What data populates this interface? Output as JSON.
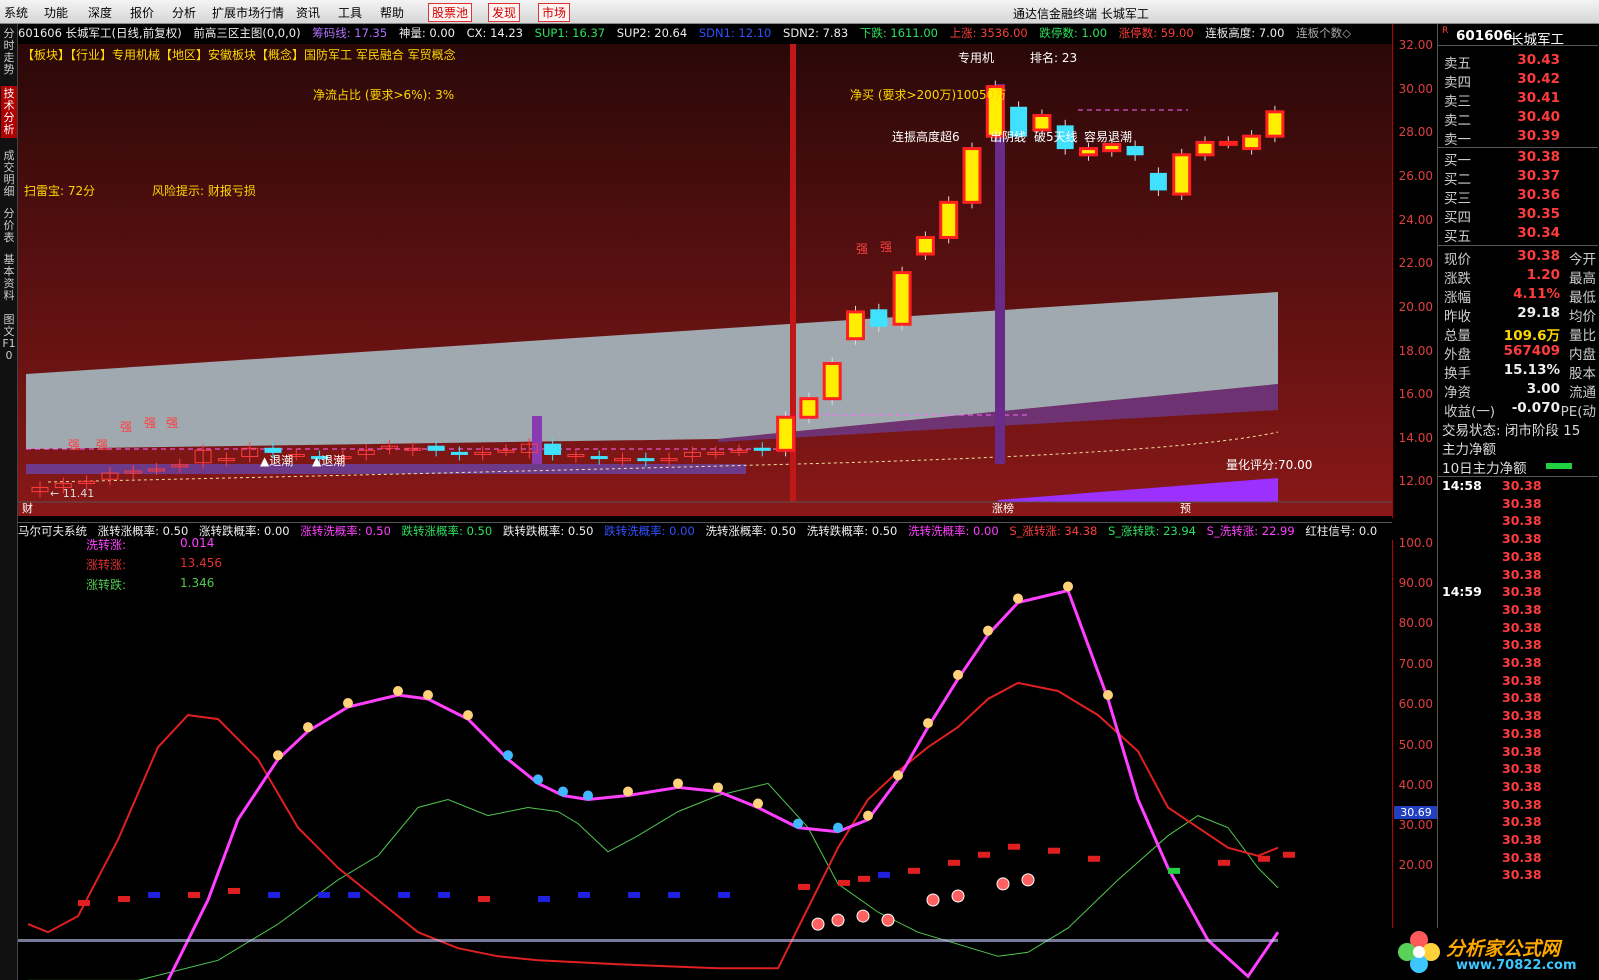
{
  "menu": {
    "items": [
      "系统",
      "功能",
      "深度",
      "报价",
      "分析",
      "扩展市场行情",
      "资讯",
      "工具",
      "帮助"
    ],
    "special": [
      "股票池",
      "发现",
      "市场"
    ],
    "title": "通达信金融终端   长城军工"
  },
  "sidebar": {
    "tabs": [
      "分时走势",
      "技术分析",
      "成交明细",
      "分价表",
      "基本资料",
      "图文F10"
    ],
    "active": 1
  },
  "infobar": {
    "stock": "601606 长城军工(日线,前复权)",
    "template": "前高三区主图(0,0,0)",
    "chouma": "筹码线: 17.35",
    "shenliang": "神量: 0.00",
    "cx": "CX: 14.23",
    "sup1": "SUP1: 16.37",
    "sup2": "SUP2: 20.64",
    "sdn1": "SDN1: 12.10",
    "sdn2": "SDN2: 7.83",
    "xiadie": "下跌: 1611.00",
    "shangzhang": "上涨: 3536.00",
    "dieting": "跌停数: 1.00",
    "zhangting": "涨停数: 59.00",
    "lianban": "连板高度: 7.00",
    "lianban_ge": "连板个数◇"
  },
  "tags": "【板块】【行业】专用机械【地区】安徽板块【概念】国防军工 军民融合 军贸概念",
  "annotations": {
    "jingliu": "净流占比 (要求>6%): 3%",
    "jingmai": "净买 (要求>200万)10050万",
    "saolei": "扫雷宝: 72分",
    "fengxian": "风险提示: 财报亏损",
    "lianbangao": "连振高度超6",
    "chuyin": "出阴线",
    "po5": "破5天线",
    "rongyi": "容易退潮",
    "zhuanyong": "专用机",
    "paiming": "排名: 23",
    "lianghua": "量化评分:70.00",
    "tuichao": "▲退潮",
    "qiang": "强",
    "lowprice": "← 11.41",
    "zhangbang": "涨榜",
    "yu": "预",
    "cai": "财"
  },
  "yaxis": {
    "main": [
      "32.00",
      "30.00",
      "28.00",
      "26.00",
      "24.00",
      "22.00",
      "20.00",
      "18.00",
      "16.00",
      "14.00",
      "12.00"
    ],
    "indi": [
      "100.0",
      "90.00",
      "80.00",
      "70.00",
      "60.00",
      "50.00",
      "40.00",
      "30.00",
      "20.00"
    ],
    "marker": "30.69"
  },
  "indi": {
    "name": "马尔可夫系统",
    "zz": "涨转涨概率: 0.50",
    "zd": "涨转跌概率: 0.00",
    "zx": "涨转洗概率: 0.50",
    "dz": "跌转涨概率: 0.50",
    "dd": "跌转跌概率: 0.50",
    "dx": "跌转洗概率: 0.00",
    "xz": "洗转涨概率: 0.50",
    "xd": "洗转跌概率: 0.50",
    "xx": "洗转洗概率: 0.00",
    "s1": "S_涨转涨: 34.38",
    "s2": "S_涨转跌: 23.94",
    "s3": "S_洗转涨: 22.99",
    "hz": "红柱信号: 0.0",
    "lines": [
      {
        "label": "洗转涨:",
        "value": "0.014"
      },
      {
        "label": "涨转涨:",
        "value": "13.456"
      },
      {
        "label": "涨转跌:",
        "value": "1.346"
      }
    ]
  },
  "quote": {
    "code": "601606",
    "name": "长城军工",
    "sells": [
      {
        "l": "卖五",
        "v": "30.43"
      },
      {
        "l": "卖四",
        "v": "30.42"
      },
      {
        "l": "卖三",
        "v": "30.41"
      },
      {
        "l": "卖二",
        "v": "30.40"
      },
      {
        "l": "卖一",
        "v": "30.39"
      }
    ],
    "buys": [
      {
        "l": "买一",
        "v": "30.38"
      },
      {
        "l": "买二",
        "v": "30.37"
      },
      {
        "l": "买三",
        "v": "30.36"
      },
      {
        "l": "买四",
        "v": "30.35"
      },
      {
        "l": "买五",
        "v": "30.34"
      }
    ],
    "stats": [
      {
        "l": "现价",
        "v": "30.38",
        "s": "今开",
        "c": "red"
      },
      {
        "l": "涨跌",
        "v": "1.20",
        "s": "最高",
        "c": "red"
      },
      {
        "l": "涨幅",
        "v": "4.11%",
        "s": "最低",
        "c": "red"
      },
      {
        "l": "昨收",
        "v": "29.18",
        "s": "均价",
        "c": "white"
      },
      {
        "l": "总量",
        "v": "109.6万",
        "s": "量比",
        "c": "yellow"
      },
      {
        "l": "外盘",
        "v": "567409",
        "s": "内盘",
        "c": "red"
      },
      {
        "l": "换手",
        "v": "15.13%",
        "s": "股本",
        "c": "white"
      },
      {
        "l": "净资",
        "v": "3.00",
        "s": "流通",
        "c": "white"
      },
      {
        "l": "收益(一)",
        "v": "-0.070",
        "s": "PE(动",
        "c": "white"
      }
    ],
    "status": "交易状态: 闭市阶段 15",
    "zhuli": "主力净额",
    "zhuli10": "10日主力净额",
    "ticks": [
      {
        "t": "14:58",
        "v": "30.38"
      },
      {
        "t": "",
        "v": "30.38"
      },
      {
        "t": "",
        "v": "30.38"
      },
      {
        "t": "",
        "v": "30.38"
      },
      {
        "t": "",
        "v": "30.38"
      },
      {
        "t": "",
        "v": "30.38"
      },
      {
        "t": "14:59",
        "v": "30.38"
      },
      {
        "t": "",
        "v": "30.38"
      },
      {
        "t": "",
        "v": "30.38"
      },
      {
        "t": "",
        "v": "30.38"
      },
      {
        "t": "",
        "v": "30.38"
      },
      {
        "t": "",
        "v": "30.38"
      },
      {
        "t": "",
        "v": "30.38"
      },
      {
        "t": "",
        "v": "30.38"
      },
      {
        "t": "",
        "v": "30.38"
      },
      {
        "t": "",
        "v": "30.38"
      },
      {
        "t": "",
        "v": "30.38"
      },
      {
        "t": "",
        "v": "30.38"
      },
      {
        "t": "",
        "v": "30.38"
      },
      {
        "t": "",
        "v": "30.38"
      },
      {
        "t": "",
        "v": "30.38"
      },
      {
        "t": "",
        "v": "30.38"
      },
      {
        "t": "",
        "v": "30.38"
      }
    ]
  },
  "logo": {
    "text": "分析家公式网",
    "url": "www.70822.com"
  }
}
